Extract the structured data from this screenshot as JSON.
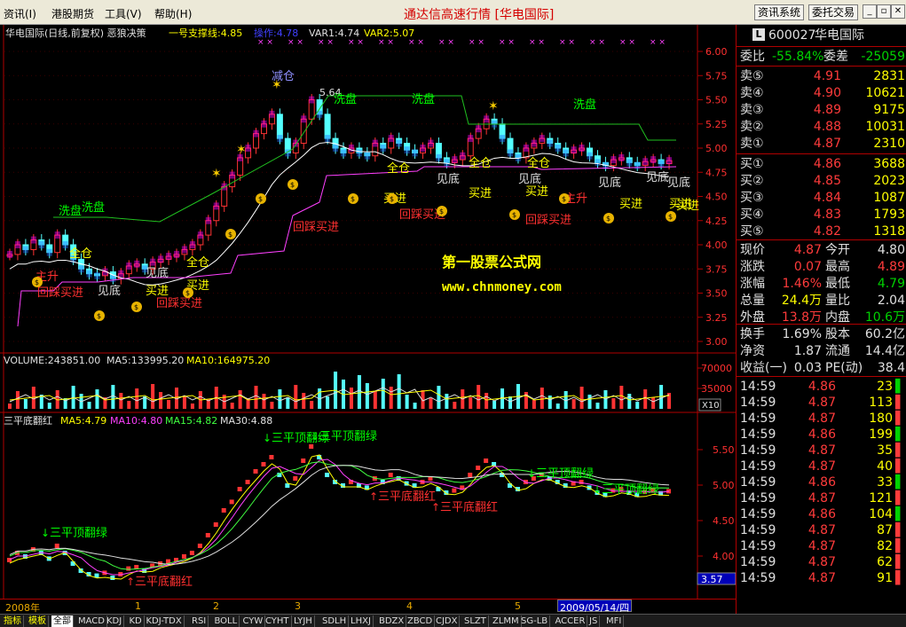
{
  "menu": {
    "items": [
      "资讯(I)",
      "港股期货",
      "工具(V)",
      "帮助(H)"
    ],
    "title": "通达信高速行情 [华电国际]",
    "btn_news": "资讯系统",
    "btn_trade": "委托交易"
  },
  "main_chart": {
    "header": {
      "name": "华电国际(日线,前复权) 恶狼决策",
      "support": "一号支撑线:4.85",
      "op": "操作:4.78",
      "var1": "VAR1:4.74",
      "var2": "VAR2:5.07"
    },
    "y_ticks": [
      "6.00",
      "5.75",
      "5.50",
      "5.25",
      "5.00",
      "4.75",
      "4.50",
      "4.25",
      "4.00",
      "3.75",
      "3.50",
      "3.25",
      "3.00"
    ],
    "high_label": "5.64",
    "watermark1": "第一股票公式网",
    "watermark2": "www.chnmoney.com",
    "annotations": [
      "减仓",
      "洗盘",
      "洗盘",
      "洗盘",
      "洗盘",
      "洗盘",
      "全仓",
      "全仓",
      "全仓",
      "全仓",
      "全仓",
      "见底",
      "见底",
      "见底",
      "见底",
      "见底",
      "见底",
      "买进",
      "买进",
      "买进",
      "买进",
      "买进",
      "买进",
      "买进",
      "回踩买进",
      "回踩买进",
      "回踩买进",
      "回踩买进",
      "回踩买进",
      "主升",
      "主升",
      "见底",
      "买进"
    ]
  },
  "volume": {
    "header": "VOLUME:243851.00",
    "ma5": "MA5:133995.20",
    "ma10": "MA10:164975.20",
    "y_ticks": [
      "70000",
      "35000"
    ],
    "unit": "X10"
  },
  "lower": {
    "header": "三平底翻红",
    "ma5": "MA5:4.79",
    "ma10": "MA10:4.80",
    "ma15": "MA15:4.82",
    "ma30": "MA30:4.88",
    "y_ticks": [
      "5.50",
      "5.00",
      "4.50",
      "4.00"
    ],
    "cursor": "3.57",
    "signals": [
      "三平顶翻绿",
      "三平顶翻绿",
      "三平顶翻绿",
      "三平顶翻绿",
      "三平顶翻绿",
      "三平底翻红",
      "三平底翻红",
      "三平底翻红"
    ]
  },
  "time_axis": {
    "labels": [
      "2008年",
      "1",
      "2",
      "3",
      "4",
      "5"
    ],
    "cursor": "2009/05/14/四"
  },
  "tabs": [
    "指标",
    "模板",
    "全部",
    "MACD",
    "KDJ",
    "KD",
    "KDJ-TDX",
    "RSI",
    "BOLL",
    "CYW",
    "CYHT",
    "LYJH",
    "SDLH",
    "LHXJ",
    "BDZX",
    "ZBCD",
    "CJDX",
    "SLZT",
    "ZLMM",
    "SG-LB",
    "ACCER",
    "JS",
    "MFI"
  ],
  "quote": {
    "code": "600027",
    "name": "华电国际",
    "weibi_label": "委比",
    "weibi": "-55.84%",
    "weicha_label": "委差",
    "weicha": "-25059",
    "asks": [
      {
        "label": "卖⑤",
        "price": "4.91",
        "vol": "2831"
      },
      {
        "label": "卖④",
        "price": "4.90",
        "vol": "10621"
      },
      {
        "label": "卖③",
        "price": "4.89",
        "vol": "9175"
      },
      {
        "label": "卖②",
        "price": "4.88",
        "vol": "10031"
      },
      {
        "label": "卖①",
        "price": "4.87",
        "vol": "2310"
      }
    ],
    "bids": [
      {
        "label": "买①",
        "price": "4.86",
        "vol": "3688"
      },
      {
        "label": "买②",
        "price": "4.85",
        "vol": "2023"
      },
      {
        "label": "买③",
        "price": "4.84",
        "vol": "1087"
      },
      {
        "label": "买④",
        "price": "4.83",
        "vol": "1793"
      },
      {
        "label": "买⑤",
        "price": "4.82",
        "vol": "1318"
      }
    ],
    "stats": [
      {
        "l1": "现价",
        "v1": "4.87",
        "c1": "red",
        "l2": "今开",
        "v2": "4.80",
        "c2": "wht"
      },
      {
        "l1": "涨跌",
        "v1": "0.07",
        "c1": "red",
        "l2": "最高",
        "v2": "4.89",
        "c2": "red"
      },
      {
        "l1": "涨幅",
        "v1": "1.46%",
        "c1": "red",
        "l2": "最低",
        "v2": "4.79",
        "c2": "grn"
      },
      {
        "l1": "总量",
        "v1": "24.4万",
        "c1": "yel",
        "l2": "量比",
        "v2": "2.04",
        "c2": "wht"
      },
      {
        "l1": "外盘",
        "v1": "13.8万",
        "c1": "red",
        "l2": "内盘",
        "v2": "10.6万",
        "c2": "grn"
      }
    ],
    "stats2": [
      {
        "l1": "换手",
        "v1": "1.69%",
        "l2": "股本",
        "v2": "60.2亿"
      },
      {
        "l1": "净资",
        "v1": "1.87",
        "l2": "流通",
        "v2": "14.4亿"
      },
      {
        "l1": "收益(一)",
        "v1": "0.03",
        "l2": "PE(动)",
        "v2": "38.4"
      }
    ],
    "ticks": [
      {
        "t": "14:59",
        "p": "4.86",
        "v": "23",
        "d": "S"
      },
      {
        "t": "14:59",
        "p": "4.87",
        "v": "113",
        "d": "B"
      },
      {
        "t": "14:59",
        "p": "4.87",
        "v": "180",
        "d": "B"
      },
      {
        "t": "14:59",
        "p": "4.86",
        "v": "199",
        "d": "S"
      },
      {
        "t": "14:59",
        "p": "4.87",
        "v": "35",
        "d": "B"
      },
      {
        "t": "14:59",
        "p": "4.87",
        "v": "40",
        "d": "B"
      },
      {
        "t": "14:59",
        "p": "4.86",
        "v": "33",
        "d": "S"
      },
      {
        "t": "14:59",
        "p": "4.87",
        "v": "121",
        "d": "B"
      },
      {
        "t": "14:59",
        "p": "4.86",
        "v": "104",
        "d": "S"
      },
      {
        "t": "14:59",
        "p": "4.87",
        "v": "87",
        "d": "B"
      },
      {
        "t": "14:59",
        "p": "4.87",
        "v": "82",
        "d": "B"
      },
      {
        "t": "14:59",
        "p": "4.87",
        "v": "62",
        "d": "B"
      },
      {
        "t": "14:59",
        "p": "4.87",
        "v": "91",
        "d": "B"
      }
    ]
  },
  "colors": {
    "up": "#ff3333",
    "down": "#54ffff",
    "frame": "#b00000",
    "label_yellow": "#ffff00",
    "label_green": "#00ff00",
    "label_red": "#ff3030"
  }
}
